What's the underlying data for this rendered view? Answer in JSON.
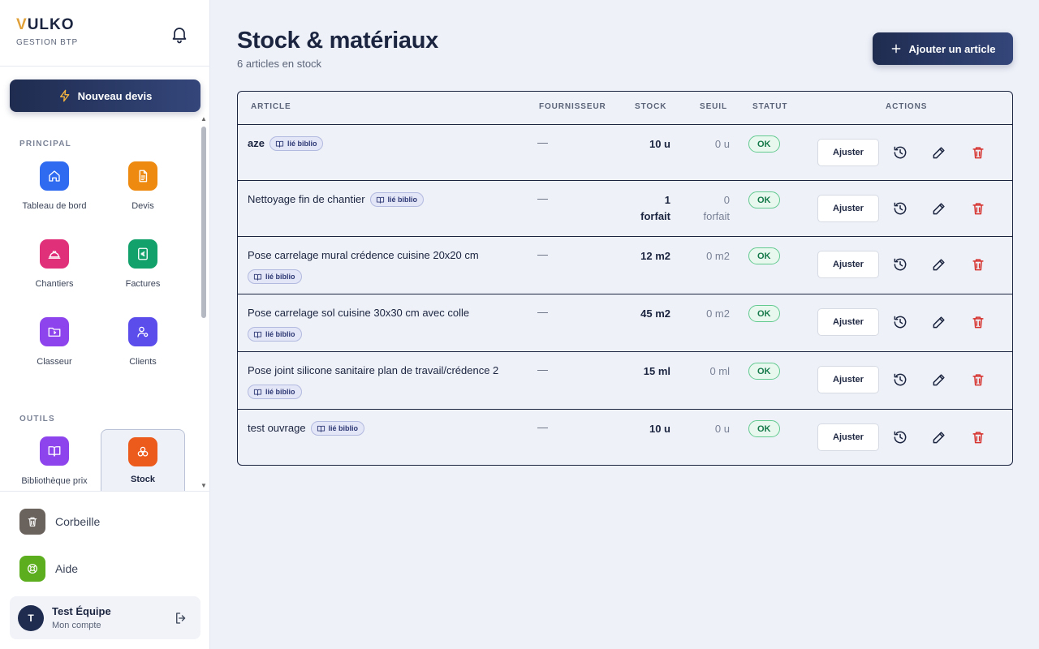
{
  "brand": {
    "letter": "V",
    "rest": "ULKO",
    "subtitle": "GESTION BTP"
  },
  "sidebar": {
    "new_quote_label": "Nouveau devis",
    "principal_label": "PRINCIPAL",
    "outils_label": "OUTILS",
    "principal_items": [
      {
        "label": "Tableau de bord",
        "icon": "home-icon",
        "color": "#2f6bf0"
      },
      {
        "label": "Devis",
        "icon": "document-icon",
        "color": "#ee8a0f"
      },
      {
        "label": "Chantiers",
        "icon": "helmet-icon",
        "color": "#e0307a"
      },
      {
        "label": "Factures",
        "icon": "euro-invoice-icon",
        "color": "#12a06b"
      },
      {
        "label": "Classeur",
        "icon": "folder-icon",
        "color": "#8e44ec"
      },
      {
        "label": "Clients",
        "icon": "user-settings-icon",
        "color": "#5b4cec"
      }
    ],
    "outils_items": [
      {
        "label": "Bibliothèque prix",
        "icon": "book-icon",
        "color": "#8e44ec"
      },
      {
        "label": "Stock",
        "icon": "boxes-icon",
        "color": "#ec5a1c"
      }
    ],
    "bottom_items": [
      {
        "label": "Corbeille",
        "icon": "trash-icon",
        "color": "#6a625c"
      },
      {
        "label": "Aide",
        "icon": "lifebuoy-icon",
        "color": "#5cae1e"
      }
    ],
    "account": {
      "initial": "T",
      "name": "Test Équipe",
      "subtitle": "Mon compte"
    }
  },
  "main": {
    "title": "Stock & matériaux",
    "subtitle": "6 articles en stock",
    "add_label": "Ajouter un article",
    "columns": [
      "ARTICLE",
      "FOURNISSEUR",
      "STOCK",
      "SEUIL",
      "STATUT",
      "ACTIONS"
    ],
    "badge_label": "lié biblio",
    "adjust_label": "Ajuster",
    "rows": [
      {
        "name": "aze",
        "bold": true,
        "badge": "inline",
        "supplier": "—",
        "stock": [
          "10 u"
        ],
        "seuil": [
          "0 u"
        ],
        "status": "OK"
      },
      {
        "name": "Nettoyage fin de chantier",
        "bold": false,
        "badge": "inline",
        "supplier": "—",
        "stock": [
          "1",
          "forfait"
        ],
        "seuil": [
          "0",
          "forfait"
        ],
        "status": "OK"
      },
      {
        "name": "Pose carrelage mural crédence cuisine 20x20 cm",
        "bold": false,
        "badge": "block",
        "supplier": "—",
        "stock": [
          "12 m2"
        ],
        "seuil": [
          "0 m2"
        ],
        "status": "OK"
      },
      {
        "name": "Pose carrelage sol cuisine 30x30 cm avec colle",
        "bold": false,
        "badge": "block",
        "supplier": "—",
        "stock": [
          "45 m2"
        ],
        "seuil": [
          "0 m2"
        ],
        "status": "OK"
      },
      {
        "name": "Pose joint silicone sanitaire plan de travail/crédence 2",
        "bold": false,
        "badge": "block",
        "supplier": "—",
        "stock": [
          "15 ml"
        ],
        "seuil": [
          "0 ml"
        ],
        "status": "OK"
      },
      {
        "name": "test ouvrage",
        "bold": false,
        "badge": "inline",
        "supplier": "—",
        "stock": [
          "10 u"
        ],
        "seuil": [
          "0 u"
        ],
        "status": "OK"
      }
    ]
  }
}
